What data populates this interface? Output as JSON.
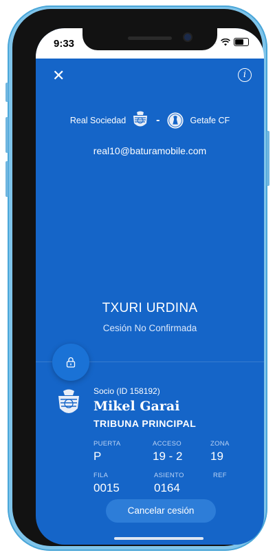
{
  "status": {
    "time": "9:33",
    "signal": "...."
  },
  "header": {
    "close_icon": "✕",
    "info_icon": "i"
  },
  "match": {
    "home_team": "Real Sociedad",
    "separator": "-",
    "away_team": "Getafe CF"
  },
  "account": {
    "email": "real10@baturamobile.com"
  },
  "ticket": {
    "title": "TXURI URDINA",
    "status": "Cesión No Confirmada",
    "holder": {
      "socio_id": "Socio (ID 158192)",
      "name": "Mikel Garai",
      "stand": "TRIBUNA PRINCIPAL"
    },
    "fields": {
      "puerta_label": "PUERTA",
      "puerta_value": "P",
      "acceso_label": "ACCESO",
      "acceso_value": "19 - 2",
      "zona_label": "ZONA",
      "zona_value": "19",
      "fila_label": "FILA",
      "fila_value": "0015",
      "asiento_label": "ASIENTO",
      "asiento_value": "0164",
      "ref_label": "REF",
      "ref_value": ""
    }
  },
  "actions": {
    "cancel_label": "Cancelar cesión"
  },
  "colors": {
    "background": "#1565c8",
    "button": "#2d7dd8",
    "frame": "#7fc4ea"
  }
}
